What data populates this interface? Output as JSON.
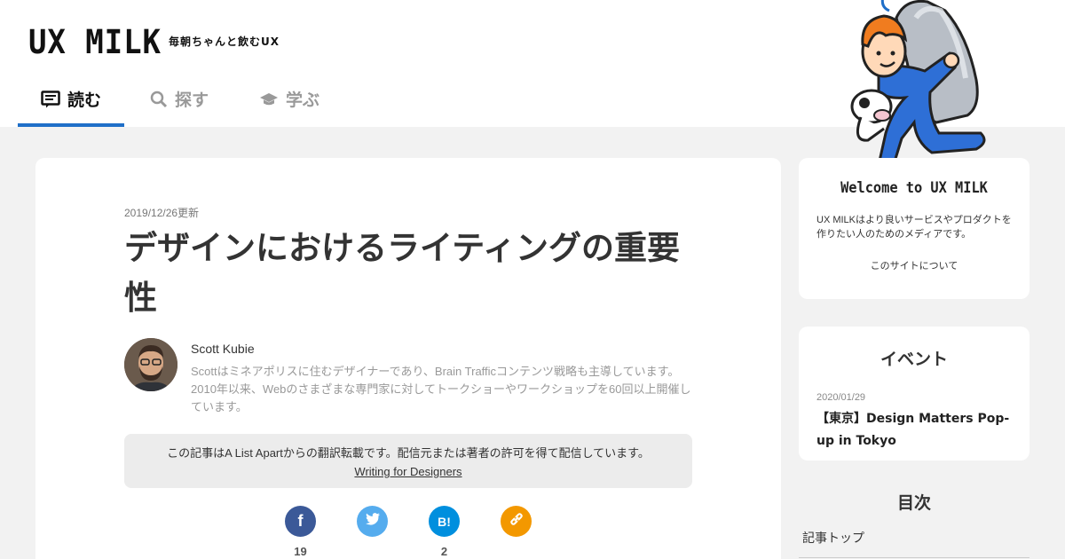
{
  "header": {
    "logo": "UX MILK",
    "tagline": "毎朝ちゃんと飲むUX",
    "tabs": [
      {
        "label": "読む",
        "icon": "reading-icon",
        "active": true
      },
      {
        "label": "探す",
        "icon": "search-icon",
        "active": false
      },
      {
        "label": "学ぶ",
        "icon": "graduation-cap-icon",
        "active": false
      }
    ]
  },
  "article": {
    "date": "2019/12/26更新",
    "title": "デザインにおけるライティングの重要性",
    "author": {
      "name": "Scott Kubie",
      "bio": "Scottはミネアポリスに住むデザイナーであり、Brain Trafficコンテンツ戦略も主導しています。2010年以来、Webのさまざまな専門家に対してトークショーやワークショップを60回以上開催しています。"
    },
    "notice": {
      "text": "この記事はA List Apartからの翻訳転載です。配信元または著者の許可を得て配信しています。",
      "link": "Writing for Designers"
    },
    "share": [
      {
        "service": "facebook",
        "glyph": "f",
        "color": "#3b5998",
        "count": "19"
      },
      {
        "service": "twitter",
        "glyph": "t",
        "color": "#55acee",
        "count": ""
      },
      {
        "service": "hatena",
        "glyph": "B!",
        "color": "#008fde",
        "count": "2"
      },
      {
        "service": "link",
        "glyph": "",
        "color": "#f39800",
        "count": ""
      }
    ]
  },
  "sidebar": {
    "welcome": {
      "title": "Welcome to UX MILK",
      "text": "UX MILKはより良いサービスやプロダクトを作りたい人のためのメディアです。",
      "link": "このサイトについて"
    },
    "event": {
      "title": "イベント",
      "date": "2020/01/29",
      "name": "【東京】Design Matters Pop-up in Tokyo"
    },
    "toc": {
      "title": "目次",
      "items": [
        "記事トップ"
      ]
    }
  },
  "colors": {
    "accent": "#1f6fc8",
    "background": "#f2f2f2"
  }
}
